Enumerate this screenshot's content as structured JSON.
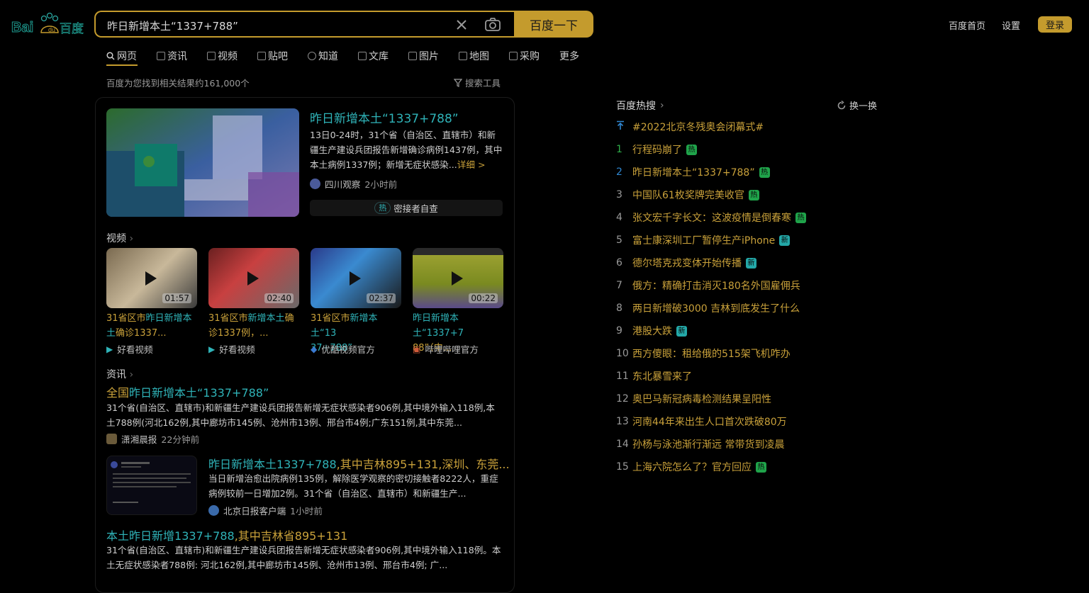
{
  "header": {
    "search_value": "昨日新增本土“1337+788”",
    "search_button": "百度一下",
    "links": [
      "百度首页",
      "设置"
    ],
    "login": "登录"
  },
  "tabs": [
    "网页",
    "资讯",
    "视频",
    "贴吧",
    "知道",
    "文库",
    "图片",
    "地图",
    "采购",
    "更多"
  ],
  "result_count": "百度为您找到相关结果约161,000个",
  "search_tools": "搜索工具",
  "top_result": {
    "title": "昨日新增本土“1337+788”",
    "desc": "13日0-24时，31个省（自治区、直辖市）和新疆生产建设兵团报告新增确诊病例1437例，其中本土病例1337例；新增无症状感染...",
    "more": "详细 >",
    "source": "四川观察",
    "time": "2小时前",
    "hot_pill": "热",
    "hot_tag": "密接者自查"
  },
  "videos_section": {
    "title": "视频",
    "items": [
      {
        "duration": "01:57",
        "title_a": "31省区市",
        "title_b": "昨日新增本",
        "title_c": "土",
        "title_d": "确诊1337...",
        "source": "好看视频"
      },
      {
        "duration": "02:40",
        "title_a": "31省区市",
        "title_b": "新增本土",
        "title_c": "确",
        "title_d": "诊1337例，...",
        "source": "好看视频"
      },
      {
        "duration": "02:37",
        "title_a": "31省区市",
        "title_b": "新增本土“13",
        "title_c": "",
        "title_d": "37+788”",
        "source": "优酷视频官方"
      },
      {
        "duration": "00:22",
        "title_a": "",
        "title_b": "昨日新增本土“1337+7",
        "title_c": "",
        "title_d": "88”（中...",
        "source": "哔哩哔哩官方"
      }
    ]
  },
  "news_section": {
    "title": "资讯",
    "item1": {
      "title_a": "全国",
      "title_b": "昨日新增本土“1337+788”",
      "desc": "31个省(自治区、直辖市)和新疆生产建设兵团报告新增无症状感染者906例,其中境外输入118例,本土788例(河北162例,其中廊坊市145例、沧州市13例、邢台市4例;广东151例,其中东莞...",
      "source": "潇湘晨报",
      "time": "22分钟前"
    },
    "item2": {
      "title_a": "昨日新增本土1337+788",
      "title_b": ",其中吉林895+131,深圳、东莞...",
      "desc": "当日新增治愈出院病例135例，解除医学观察的密切接触者8222人，重症病例较前一日增加2例。31个省（自治区、直辖市）和新疆生产...",
      "source": "北京日报客户端",
      "time": "1小时前"
    },
    "item3": {
      "title_a": "本土",
      "title_b": "昨日新增1337+788",
      "title_c": ",其中吉林省895+131",
      "desc": "31个省(自治区、直辖市)和新疆生产建设兵团报告新增无症状感染者906例,其中境外输入118例。本土无症状感染者788例: 河北162例,其中廊坊市145例、沧州市13例、邢台市4例; 广..."
    }
  },
  "hot_list": {
    "title": "百度热搜",
    "refresh": "换一换",
    "top_item": "#2022北京冬残奥会闭幕式#",
    "items": [
      {
        "rank": "1",
        "text": "行程码崩了",
        "badge": "热",
        "badge_type": "hot"
      },
      {
        "rank": "2",
        "text": "昨日新增本土“1337+788”",
        "badge": "热",
        "badge_type": "hot"
      },
      {
        "rank": "3",
        "text": "中国队61枚奖牌完美收官",
        "badge": "热",
        "badge_type": "hot"
      },
      {
        "rank": "4",
        "text": "张文宏千字长文：这波疫情是倒春寒",
        "badge": "热",
        "badge_type": "hot"
      },
      {
        "rank": "5",
        "text": "富士康深圳工厂暂停生产iPhone",
        "badge": "新",
        "badge_type": "new"
      },
      {
        "rank": "6",
        "text": "德尔塔克戎变体开始传播",
        "badge": "新",
        "badge_type": "new"
      },
      {
        "rank": "7",
        "text": "俄方：精确打击消灭180名外国雇佣兵",
        "badge": "",
        "badge_type": ""
      },
      {
        "rank": "8",
        "text": "两日新增破3000 吉林到底发生了什么",
        "badge": "",
        "badge_type": ""
      },
      {
        "rank": "9",
        "text": "港股大跌",
        "badge": "新",
        "badge_type": "new"
      },
      {
        "rank": "10",
        "text": "西方傻眼：租给俄的515架飞机咋办",
        "badge": "",
        "badge_type": ""
      },
      {
        "rank": "11",
        "text": "东北暴雪来了",
        "badge": "",
        "badge_type": ""
      },
      {
        "rank": "12",
        "text": "奥巴马新冠病毒检测结果呈阳性",
        "badge": "",
        "badge_type": ""
      },
      {
        "rank": "13",
        "text": "河南44年来出生人口首次跌破80万",
        "badge": "",
        "badge_type": ""
      },
      {
        "rank": "14",
        "text": "孙杨与泳池渐行渐远 常带货到凌晨",
        "badge": "",
        "badge_type": ""
      },
      {
        "rank": "15",
        "text": "上海六院怎么了？官方回应",
        "badge": "热",
        "badge_type": "hot"
      }
    ]
  },
  "colors": {
    "accent": "#c49b2d",
    "link": "#c9a13a",
    "highlight": "#2fb3b8",
    "hot_badge": "#1fa34a",
    "new_badge": "#23a8a8"
  }
}
